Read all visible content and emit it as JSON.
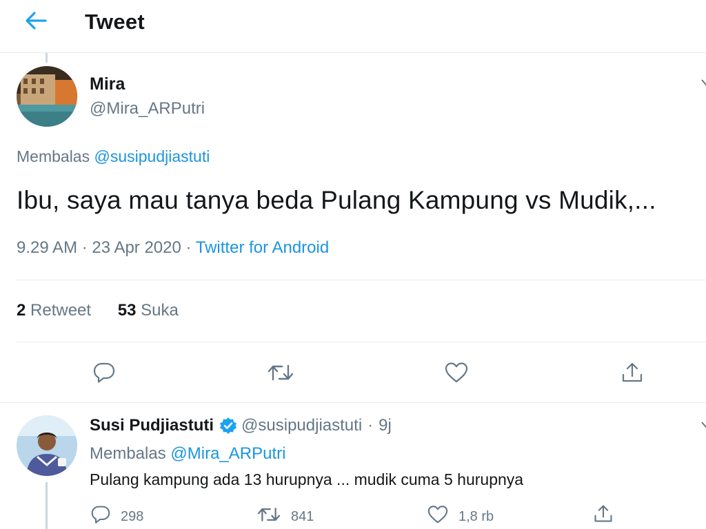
{
  "header": {
    "title": "Tweet",
    "back_icon": "arrow-left-icon"
  },
  "colors": {
    "accent": "#1da1f2",
    "link": "#1b95e0",
    "text": "#14171a",
    "muted": "#657786",
    "divider": "#e6ecf0",
    "verified": "#1da1f2"
  },
  "main_tweet": {
    "author_name": "Mira",
    "author_handle": "@Mira_ARPutri",
    "replying_label": "Membalas",
    "replying_to": "@susipudjiastuti",
    "text": "Ibu, saya mau tanya beda Pulang Kampung vs Mudik,...",
    "time": "9.29 AM",
    "sep1": "·",
    "date": "23 Apr 2020",
    "sep2": "·",
    "source": "Twitter for Android",
    "retweet_count": "2",
    "retweet_label": "Retweet",
    "like_count": "53",
    "like_label": "Suka",
    "action_icons": [
      "reply-icon",
      "retweet-icon",
      "like-icon",
      "share-icon"
    ]
  },
  "reply_tweet": {
    "author_name": "Susi Pudjiastuti",
    "verified": true,
    "author_handle": "@susipudjiastuti",
    "sep": "·",
    "time": "9j",
    "replying_label": "Membalas",
    "replying_to": "@Mira_ARPutri",
    "text": "Pulang kampung ada 13 hurupnya ... mudik cuma 5 hurupnya",
    "reply_count": "298",
    "retweet_count": "841",
    "like_count": "1,8 rb"
  }
}
